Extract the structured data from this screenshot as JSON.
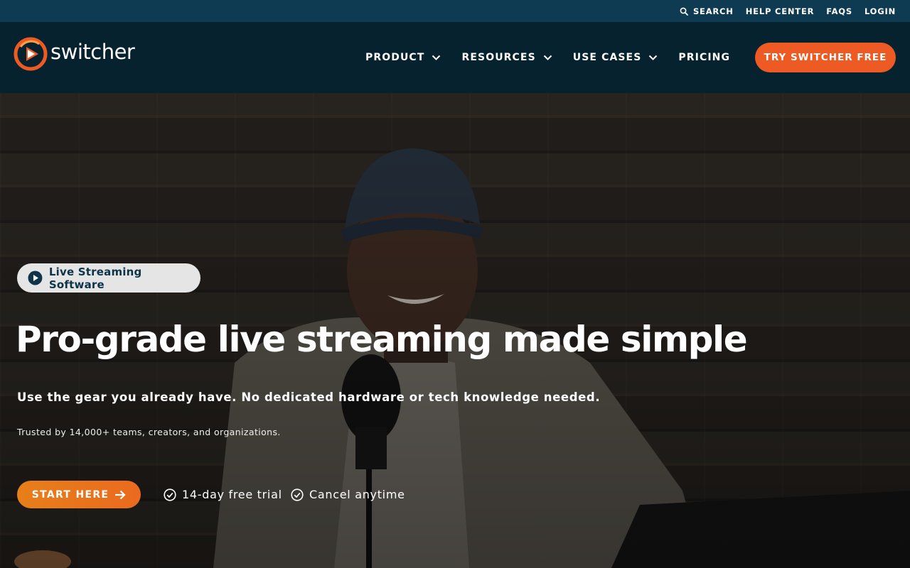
{
  "utility_nav": {
    "search_label": "SEARCH",
    "help_label": "HELP CENTER",
    "faqs_label": "FAQS",
    "login_label": "LOGIN"
  },
  "brand": {
    "name": "switcher",
    "accent": "#ed5a24",
    "navy": "#06222f"
  },
  "main_nav": {
    "product_label": "PRODUCT",
    "resources_label": "RESOURCES",
    "use_cases_label": "USE CASES",
    "pricing_label": "PRICING"
  },
  "cta": {
    "try_free_label": "TRY SWITCHER FREE"
  },
  "hero": {
    "badge_label": "Live Streaming Software",
    "headline": "Pro-grade live streaming made simple",
    "subhead": "Use the gear you already have. No dedicated hardware or tech knowledge needed.",
    "trust_line": "Trusted by 14,000+ teams, creators, and organizations.",
    "start_label": "START HERE",
    "feature_1": "14-day free trial",
    "feature_2": "Cancel anytime"
  },
  "icons": {
    "search": "search-icon",
    "chevron": "chevron-down-icon",
    "play": "play-circle-icon",
    "arrow": "arrow-right-icon",
    "check": "check-circle-icon",
    "logo": "switcher-logo-icon"
  }
}
